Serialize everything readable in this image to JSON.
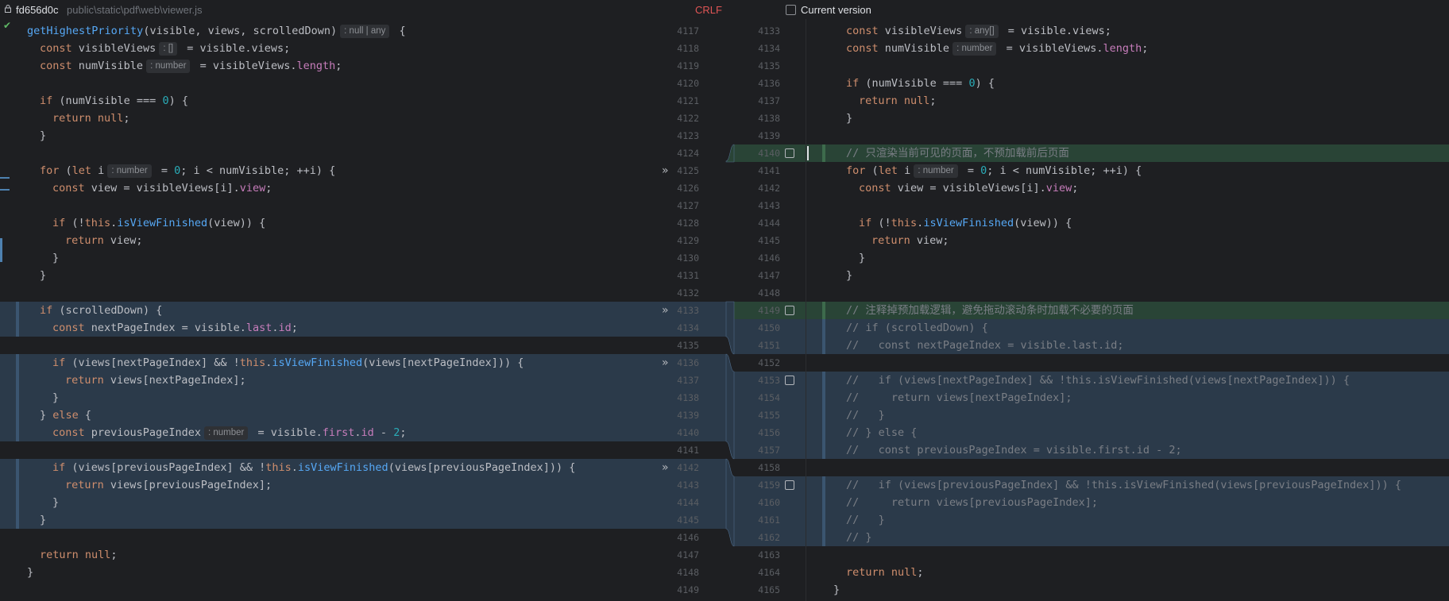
{
  "header": {
    "commit": "fd656d0c",
    "path": "public\\static\\pdf\\web\\viewer.js",
    "line_ending": "CRLF",
    "current_version_label": "Current version",
    "current_version_checked": false
  },
  "icons": {
    "lock": "lock-icon",
    "check": "checkmark-icon",
    "apply": "double-chevron-right-icon",
    "accept": "checkbox-icon"
  },
  "colors": {
    "background": "#1e1f22",
    "changed_block": "#2b3a4a",
    "inserted_block": "#294436",
    "keyword": "#cf8e6d",
    "function": "#56a8f5",
    "property": "#c77dbb",
    "number": "#2aacb8",
    "comment": "#7a7e85"
  },
  "left_code": [
    {
      "hl": "",
      "ind": 0,
      "t": [
        [
          "fn",
          "getHighestPriority"
        ],
        [
          "",
          "(visible, views, scrolledDown)"
        ],
        [
          "hint",
          ": null | any"
        ],
        [
          "",
          " {"
        ]
      ]
    },
    {
      "hl": "",
      "ind": 1,
      "t": [
        [
          "kw",
          "const "
        ],
        [
          "",
          "visibleViews"
        ],
        [
          "hint",
          ": []"
        ],
        [
          "",
          " = visible.views;"
        ]
      ]
    },
    {
      "hl": "",
      "ind": 1,
      "t": [
        [
          "kw",
          "const "
        ],
        [
          "",
          "numVisible"
        ],
        [
          "hint",
          ": number"
        ],
        [
          "",
          " = visibleViews."
        ],
        [
          "prop",
          "length"
        ],
        [
          "",
          ";"
        ]
      ]
    },
    {
      "hl": "",
      "ind": 0,
      "t": []
    },
    {
      "hl": "",
      "ind": 1,
      "t": [
        [
          "kw",
          "if "
        ],
        [
          "",
          "(numVisible === "
        ],
        [
          "num",
          "0"
        ],
        [
          "",
          ") {"
        ]
      ]
    },
    {
      "hl": "",
      "ind": 2,
      "t": [
        [
          "kw",
          "return null"
        ],
        [
          "",
          ";"
        ]
      ]
    },
    {
      "hl": "",
      "ind": 1,
      "t": [
        [
          "",
          "}"
        ]
      ]
    },
    {
      "hl": "",
      "ind": 0,
      "t": []
    },
    {
      "hl": "",
      "ind": 1,
      "t": [
        [
          "kw",
          "for "
        ],
        [
          "",
          "("
        ],
        [
          "kw",
          "let "
        ],
        [
          "",
          "i"
        ],
        [
          "hint",
          ": number"
        ],
        [
          "",
          " = "
        ],
        [
          "num",
          "0"
        ],
        [
          "",
          "; i < numVisible; ++i) {"
        ]
      ]
    },
    {
      "hl": "",
      "ind": 2,
      "t": [
        [
          "kw",
          "const "
        ],
        [
          "",
          "view = visibleViews[i]."
        ],
        [
          "prop",
          "view"
        ],
        [
          "",
          ";"
        ]
      ]
    },
    {
      "hl": "",
      "ind": 0,
      "t": []
    },
    {
      "hl": "",
      "ind": 2,
      "t": [
        [
          "kw",
          "if "
        ],
        [
          "",
          "(!"
        ],
        [
          "kw",
          "this"
        ],
        [
          "",
          "."
        ],
        [
          "fn",
          "isViewFinished"
        ],
        [
          "",
          "(view)) {"
        ]
      ]
    },
    {
      "hl": "",
      "ind": 3,
      "t": [
        [
          "kw",
          "return "
        ],
        [
          "",
          "view;"
        ]
      ]
    },
    {
      "hl": "",
      "ind": 2,
      "t": [
        [
          "",
          "}"
        ]
      ]
    },
    {
      "hl": "",
      "ind": 1,
      "t": [
        [
          "",
          "}"
        ]
      ]
    },
    {
      "hl": "",
      "ind": 0,
      "t": []
    },
    {
      "hl": "blue",
      "ind": 1,
      "t": [
        [
          "kw",
          "if "
        ],
        [
          "",
          "(scrolledDown) {"
        ]
      ]
    },
    {
      "hl": "blue",
      "ind": 2,
      "t": [
        [
          "kw",
          "const "
        ],
        [
          "",
          "nextPageIndex = visible."
        ],
        [
          "prop",
          "last"
        ],
        [
          "",
          "."
        ],
        [
          "prop",
          "id"
        ],
        [
          "",
          ";"
        ]
      ]
    },
    {
      "hl": "",
      "ind": 0,
      "t": []
    },
    {
      "hl": "blue",
      "ind": 2,
      "t": [
        [
          "kw",
          "if "
        ],
        [
          "",
          "(views[nextPageIndex] && !"
        ],
        [
          "kw",
          "this"
        ],
        [
          "",
          "."
        ],
        [
          "fn",
          "isViewFinished"
        ],
        [
          "",
          "(views[nextPageIndex])) {"
        ]
      ]
    },
    {
      "hl": "blue",
      "ind": 3,
      "t": [
        [
          "kw",
          "return "
        ],
        [
          "",
          "views[nextPageIndex];"
        ]
      ]
    },
    {
      "hl": "blue",
      "ind": 2,
      "t": [
        [
          "",
          "}"
        ]
      ]
    },
    {
      "hl": "blue",
      "ind": 1,
      "t": [
        [
          "",
          "} "
        ],
        [
          "kw",
          "else "
        ],
        [
          "",
          "{"
        ]
      ]
    },
    {
      "hl": "blue",
      "ind": 2,
      "t": [
        [
          "kw",
          "const "
        ],
        [
          "",
          "previousPageIndex"
        ],
        [
          "hint",
          ": number"
        ],
        [
          "",
          " = visible."
        ],
        [
          "prop",
          "first"
        ],
        [
          "",
          "."
        ],
        [
          "prop",
          "id"
        ],
        [
          "",
          " - "
        ],
        [
          "num",
          "2"
        ],
        [
          "",
          ";"
        ]
      ]
    },
    {
      "hl": "",
      "ind": 0,
      "t": []
    },
    {
      "hl": "blue",
      "ind": 2,
      "t": [
        [
          "kw",
          "if "
        ],
        [
          "",
          "(views[previousPageIndex] && !"
        ],
        [
          "kw",
          "this"
        ],
        [
          "",
          "."
        ],
        [
          "fn",
          "isViewFinished"
        ],
        [
          "",
          "(views[previousPageIndex])) {"
        ]
      ]
    },
    {
      "hl": "blue",
      "ind": 3,
      "t": [
        [
          "kw",
          "return "
        ],
        [
          "",
          "views[previousPageIndex];"
        ]
      ]
    },
    {
      "hl": "blue",
      "ind": 2,
      "t": [
        [
          "",
          "}"
        ]
      ]
    },
    {
      "hl": "blue",
      "ind": 1,
      "t": [
        [
          "",
          "}"
        ]
      ]
    },
    {
      "hl": "",
      "ind": 0,
      "t": []
    },
    {
      "hl": "",
      "ind": 1,
      "t": [
        [
          "kw",
          "return null"
        ],
        [
          "",
          ";"
        ]
      ]
    },
    {
      "hl": "",
      "ind": 0,
      "t": [
        [
          "",
          "}"
        ]
      ]
    }
  ],
  "right_code": [
    {
      "hl": "",
      "ind": 1,
      "t": [
        [
          "kw",
          "const "
        ],
        [
          "",
          "visibleViews"
        ],
        [
          "hint",
          ": any[]"
        ],
        [
          "",
          " = visible.views;"
        ]
      ]
    },
    {
      "hl": "",
      "ind": 1,
      "t": [
        [
          "kw",
          "const "
        ],
        [
          "",
          "numVisible"
        ],
        [
          "hint",
          ": number"
        ],
        [
          "",
          " = visibleViews."
        ],
        [
          "prop",
          "length"
        ],
        [
          "",
          ";"
        ]
      ]
    },
    {
      "hl": "",
      "ind": 0,
      "t": []
    },
    {
      "hl": "",
      "ind": 1,
      "t": [
        [
          "kw",
          "if "
        ],
        [
          "",
          "(numVisible === "
        ],
        [
          "num",
          "0"
        ],
        [
          "",
          ") {"
        ]
      ]
    },
    {
      "hl": "",
      "ind": 2,
      "t": [
        [
          "kw",
          "return null"
        ],
        [
          "",
          ";"
        ]
      ]
    },
    {
      "hl": "",
      "ind": 1,
      "t": [
        [
          "",
          "}"
        ]
      ]
    },
    {
      "hl": "",
      "ind": 0,
      "t": []
    },
    {
      "hl": "green",
      "ind": 1,
      "t": [
        [
          "cm",
          "// 只渲染当前可见的页面，不预加载前后页面"
        ]
      ]
    },
    {
      "hl": "",
      "ind": 1,
      "t": [
        [
          "kw",
          "for "
        ],
        [
          "",
          "("
        ],
        [
          "kw",
          "let "
        ],
        [
          "",
          "i"
        ],
        [
          "hint",
          ": number"
        ],
        [
          "",
          " = "
        ],
        [
          "num",
          "0"
        ],
        [
          "",
          "; i < numVisible; ++i) {"
        ]
      ]
    },
    {
      "hl": "",
      "ind": 2,
      "t": [
        [
          "kw",
          "const "
        ],
        [
          "",
          "view = visibleViews[i]."
        ],
        [
          "prop",
          "view"
        ],
        [
          "",
          ";"
        ]
      ]
    },
    {
      "hl": "",
      "ind": 0,
      "t": []
    },
    {
      "hl": "",
      "ind": 2,
      "t": [
        [
          "kw",
          "if "
        ],
        [
          "",
          "(!"
        ],
        [
          "kw",
          "this"
        ],
        [
          "",
          "."
        ],
        [
          "fn",
          "isViewFinished"
        ],
        [
          "",
          "(view)) {"
        ]
      ]
    },
    {
      "hl": "",
      "ind": 3,
      "t": [
        [
          "kw",
          "return "
        ],
        [
          "",
          "view;"
        ]
      ]
    },
    {
      "hl": "",
      "ind": 2,
      "t": [
        [
          "",
          "}"
        ]
      ]
    },
    {
      "hl": "",
      "ind": 1,
      "t": [
        [
          "",
          "}"
        ]
      ]
    },
    {
      "hl": "",
      "ind": 0,
      "t": []
    },
    {
      "hl": "green",
      "ind": 1,
      "t": [
        [
          "cm",
          "// 注释掉预加载逻辑，避免拖动滚动条时加载不必要的页面"
        ]
      ]
    },
    {
      "hl": "blue",
      "ind": 1,
      "t": [
        [
          "cm",
          "// if (scrolledDown) {"
        ]
      ]
    },
    {
      "hl": "blue",
      "ind": 1,
      "t": [
        [
          "cm",
          "//   const nextPageIndex = visible.last.id;"
        ]
      ]
    },
    {
      "hl": "",
      "ind": 0,
      "t": []
    },
    {
      "hl": "blue",
      "ind": 1,
      "t": [
        [
          "cm",
          "//   if (views[nextPageIndex] && !this.isViewFinished(views[nextPageIndex])) {"
        ]
      ]
    },
    {
      "hl": "blue",
      "ind": 1,
      "t": [
        [
          "cm",
          "//     return views[nextPageIndex];"
        ]
      ]
    },
    {
      "hl": "blue",
      "ind": 1,
      "t": [
        [
          "cm",
          "//   }"
        ]
      ]
    },
    {
      "hl": "blue",
      "ind": 1,
      "t": [
        [
          "cm",
          "// } else {"
        ]
      ]
    },
    {
      "hl": "blue",
      "ind": 1,
      "t": [
        [
          "cm",
          "//   const previousPageIndex = visible.first.id - 2;"
        ]
      ]
    },
    {
      "hl": "",
      "ind": 0,
      "t": []
    },
    {
      "hl": "blue",
      "ind": 1,
      "t": [
        [
          "cm",
          "//   if (views[previousPageIndex] && !this.isViewFinished(views[previousPageIndex])) {"
        ]
      ]
    },
    {
      "hl": "blue",
      "ind": 1,
      "t": [
        [
          "cm",
          "//     return views[previousPageIndex];"
        ]
      ]
    },
    {
      "hl": "blue",
      "ind": 1,
      "t": [
        [
          "cm",
          "//   }"
        ]
      ]
    },
    {
      "hl": "blue",
      "ind": 1,
      "t": [
        [
          "cm",
          "// }"
        ]
      ]
    },
    {
      "hl": "",
      "ind": 0,
      "t": []
    },
    {
      "hl": "",
      "ind": 1,
      "t": [
        [
          "kw",
          "return null"
        ],
        [
          "",
          ";"
        ]
      ]
    },
    {
      "hl": "",
      "ind": 0,
      "t": [
        [
          "",
          "}"
        ]
      ]
    }
  ],
  "left_numbers": [
    "4117",
    "4118",
    "4119",
    "4120",
    "4121",
    "4122",
    "4123",
    "4124",
    "4125",
    "4126",
    "4127",
    "4128",
    "4129",
    "4130",
    "4131",
    "4132",
    "4133",
    "4134",
    "4135",
    "4136",
    "4137",
    "4138",
    "4139",
    "4140",
    "4141",
    "4142",
    "4143",
    "4144",
    "4145",
    "4146",
    "4147",
    "4148",
    "4149"
  ],
  "right_numbers": [
    "4133",
    "4134",
    "4135",
    "4136",
    "4137",
    "4138",
    "4139",
    "4140",
    "4141",
    "4142",
    "4143",
    "4144",
    "4145",
    "4146",
    "4147",
    "4148",
    "4149",
    "4150",
    "4151",
    "4152",
    "4153",
    "4154",
    "4155",
    "4156",
    "4157",
    "4158",
    "4159",
    "4160",
    "4161",
    "4162",
    "4163",
    "4164",
    "4165"
  ]
}
